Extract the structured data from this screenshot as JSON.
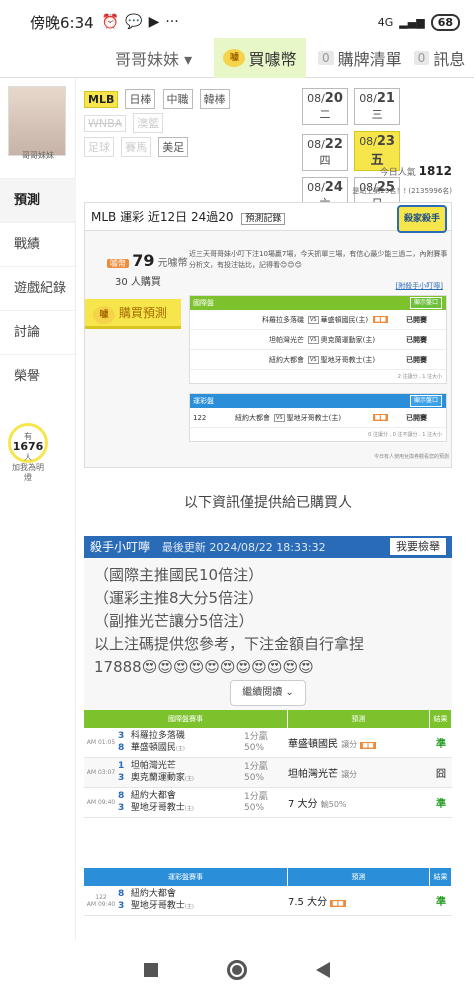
{
  "status": {
    "time": "傍晚6:34",
    "battery": "68",
    "net": "4G"
  },
  "topnav": {
    "user": "哥哥妹妹 ▾",
    "buy": "買噱幣",
    "cart_count": "0",
    "cart": "購牌清單",
    "msg_count": "0",
    "msg": "訊息"
  },
  "sidebar": {
    "name": "哥哥妹妹",
    "items": [
      "預測",
      "戰績",
      "遊戲紀錄",
      "討論",
      "榮譽"
    ],
    "fans_prefix": "有",
    "fans": "1676",
    "fans_suffix": "人",
    "fans_label": "加我為明燈"
  },
  "sports": {
    "row1": [
      "MLB",
      "日棒",
      "中職",
      "韓棒"
    ],
    "row2": [
      "WNBA",
      "澳籃"
    ],
    "row3": [
      "足球",
      "賽馬",
      "美足"
    ]
  },
  "dates": [
    {
      "pre": "08/",
      "day": "20",
      "wd": "二"
    },
    {
      "pre": "08/",
      "day": "21",
      "wd": "三"
    },
    {
      "pre": "08/",
      "day": "22",
      "wd": "四"
    },
    {
      "pre": "08/",
      "day": "23",
      "wd": "五"
    },
    {
      "pre": "08/",
      "day": "24",
      "wd": "六"
    },
    {
      "pre": "08/",
      "day": "25",
      "wd": "日"
    }
  ],
  "popularity": {
    "label": "今日人氣",
    "value": "1812",
    "rank": "是站上第29名！! (2135996名)"
  },
  "pick": {
    "header": "MLB 運彩 近12日 24過20",
    "rec_label": "預測記錄",
    "badge": "殺家殺手",
    "coin_label": "噱幣",
    "price": "79",
    "price_unit": "元噱幣",
    "buyers": "30",
    "buyers_unit": "人購買",
    "buy_button": "購買預測",
    "desc": "近三天哥哥妹小叮下注10場贏7場，今天抓單三場，有信心最少能三過二，內附賽事分析文，有投注钴比，記得看😊😊😊",
    "see_more": "[附殺手小叮嚀]",
    "intl_header": "國際盤",
    "show_button": "顯示盤口",
    "intl_rows": [
      {
        "away": "科羅拉多落磯",
        "home": "華盛頓國民(主)",
        "status": "已開賽"
      },
      {
        "away": "坦帕灣光芒",
        "home": "奧克蘭運動家(主)",
        "status": "已開賽"
      },
      {
        "away": "紐約大都會",
        "home": "聖地牙哥教士(主)",
        "status": "已開賽"
      }
    ],
    "intl_foot": "2 注讓分 , 1 注大小",
    "lottery_header": "運彩盤",
    "lottery_rows": [
      {
        "id": "122",
        "away": "紐約大都會",
        "home": "聖地牙哥教士(主)",
        "status": "已開賽"
      }
    ],
    "lottery_foot": "0 注讓分 , 0 注不讓分 , 1 注大小",
    "note": "今日有人使用兌換券觀看您的預測"
  },
  "info_msg": "以下資訊僅提供給已購買人",
  "memo": {
    "title": "殺手小叮嚀",
    "updated": "最後更新 2024/08/22 18:33:32",
    "report": "我要檢舉",
    "lines": [
      "（國際主推國民10倍注）",
      "（運彩主推8大分5倍注）",
      "（副推光芒讓分5倍注）",
      "以上注碼提供您參考，下注金額自行拿捏",
      "17888😍😍😍😍😍😍😍😍😍😍😍"
    ],
    "continue": "繼續閱讀"
  },
  "results": {
    "intl_cols": [
      "國際盤賽事",
      "預測",
      "結果"
    ],
    "intl_rows": [
      {
        "time": "AM 01:05",
        "n1": "3",
        "t1": "科羅拉多落磯",
        "n2": "8",
        "t2": "華盛頓國民",
        "home": "(主)",
        "line1": "1分贏",
        "line2": "50%",
        "pick": "華盛頓國民",
        "ptype": "讓分",
        "res": "準"
      },
      {
        "time": "AM 03:07",
        "n1": "1",
        "t1": "坦帕灣光芒",
        "n2": "3",
        "t2": "奧克蘭運動家",
        "home": "(主)",
        "line1": "1分贏",
        "line2": "50%",
        "pick": "坦帕灣光芒",
        "ptype": "讓分",
        "res": "囧"
      },
      {
        "time": "AM 09:40",
        "n1": "8",
        "t1": "紐約大都會",
        "n2": "3",
        "t2": "聖地牙哥教士",
        "home": "(主)",
        "line1": "1分贏",
        "line2": "50%",
        "pick": "7 大分",
        "ptype": "輸50%",
        "res": "準"
      }
    ],
    "lottery_cols": [
      "運彩盤賽事",
      "預測",
      "結果"
    ],
    "lottery_rows": [
      {
        "id": "122",
        "time": "AM 09:40",
        "n1": "8",
        "t1": "紐約大都會",
        "n2": "3",
        "t2": "聖地牙哥教士",
        "home": "(主)",
        "pick": "7.5 大分",
        "res": "準"
      }
    ]
  }
}
